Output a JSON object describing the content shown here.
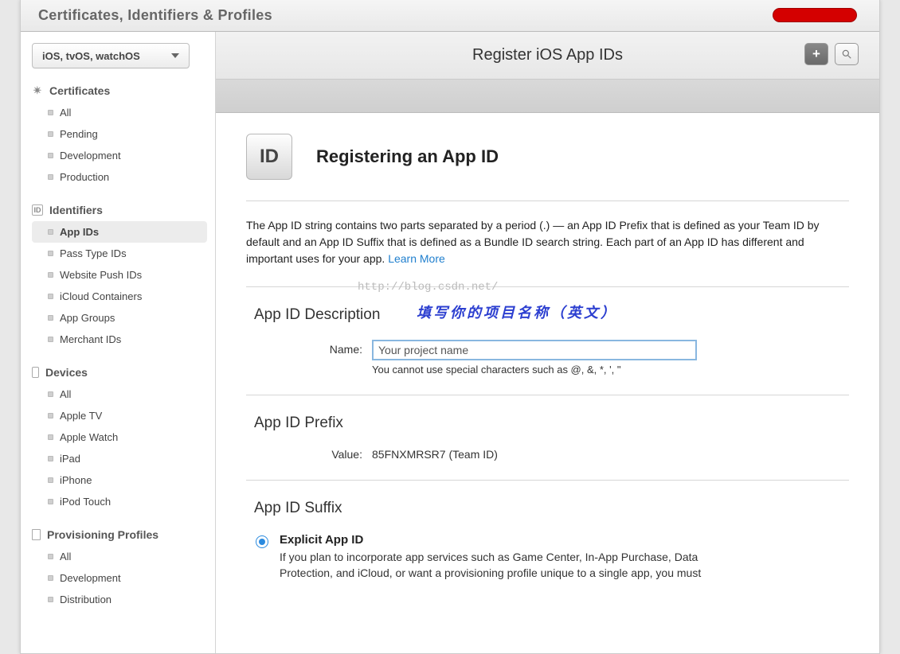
{
  "titlebar": {
    "title": "Certificates, Identifiers & Profiles"
  },
  "sidebar": {
    "platform_selector": "iOS, tvOS, watchOS",
    "sections": {
      "certificates": {
        "title": "Certificates",
        "items": [
          {
            "label": "All"
          },
          {
            "label": "Pending"
          },
          {
            "label": "Development"
          },
          {
            "label": "Production"
          }
        ]
      },
      "identifiers": {
        "title": "Identifiers",
        "items": [
          {
            "label": "App IDs"
          },
          {
            "label": "Pass Type IDs"
          },
          {
            "label": "Website Push IDs"
          },
          {
            "label": "iCloud Containers"
          },
          {
            "label": "App Groups"
          },
          {
            "label": "Merchant IDs"
          }
        ]
      },
      "devices": {
        "title": "Devices",
        "items": [
          {
            "label": "All"
          },
          {
            "label": "Apple TV"
          },
          {
            "label": "Apple Watch"
          },
          {
            "label": "iPad"
          },
          {
            "label": "iPhone"
          },
          {
            "label": "iPod Touch"
          }
        ]
      },
      "provisioning": {
        "title": "Provisioning Profiles",
        "items": [
          {
            "label": "All"
          },
          {
            "label": "Development"
          },
          {
            "label": "Distribution"
          }
        ]
      }
    }
  },
  "page_header": {
    "title": "Register iOS App IDs"
  },
  "main": {
    "heading_icon_text": "ID",
    "heading": "Registering an App ID",
    "intro": "The App ID string contains two parts separated by a period (.) — an App ID Prefix that is defined as your Team ID by default and an App ID Suffix that is defined as a Bundle ID search string. Each part of an App ID has different and important uses for your app. ",
    "learn_more": "Learn More",
    "description_section": {
      "title": "App ID Description",
      "name_label": "Name:",
      "name_value": "Your project name",
      "name_hint": "You cannot use special characters such as @, &, *, ', \"",
      "watermark": "http://blog.csdn.net/",
      "annotation_cn": "填写你的项目名称（英文）"
    },
    "prefix_section": {
      "title": "App ID Prefix",
      "value_label": "Value:",
      "value_text": "85FNXMRSR7 (Team ID)"
    },
    "suffix_section": {
      "title": "App ID Suffix",
      "explicit_title": "Explicit App ID",
      "explicit_desc": "If you plan to incorporate app services such as Game Center, In-App Purchase, Data Protection, and iCloud, or want a provisioning profile unique to a single app, you must"
    }
  }
}
